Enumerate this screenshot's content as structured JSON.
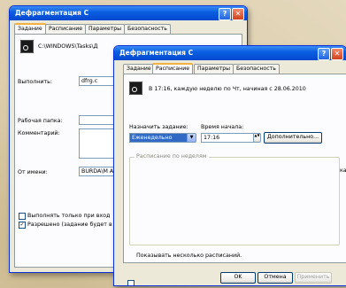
{
  "back_window": {
    "title": "Дефрагментация C",
    "tabs": [
      "Задание",
      "Расписание",
      "Параметры",
      "Безопасность"
    ],
    "task_path": "C:\\WINDOWS\\Tasks\\Д",
    "run_label": "Выполнить:",
    "run_value": "dfrg.c",
    "workdir_label": "Рабочая папка:",
    "comment_label": "Комментарий:",
    "runas_label": "От имени:",
    "runas_value": "BURDA\\M Ан",
    "only_if_logged_label": "Выполнять только при вход",
    "enabled_label": "Разрешено (задание будет в"
  },
  "front_window": {
    "title": "Дефрагментация C",
    "tabs": [
      "Задание",
      "Расписание",
      "Параметры",
      "Безопасность"
    ],
    "schedule_summary": "В 17:16, каждую неделю по Чт, начиная с 28.06.2010",
    "assign_label": "Назначить задание:",
    "assign_value": "Еженедельно",
    "start_time_label": "Время начала:",
    "start_time_value": "17:16",
    "advanced_button": "Дополнительно...",
    "weekly_group_label": "Расписание по неделям",
    "side_cut_text": "ка",
    "show_multiple_label": "Показывать несколько расписаний.",
    "ok_button": "OK",
    "cancel_button": "Отмена",
    "apply_button": "Применить"
  },
  "colors": {
    "titlebar": "#0548d0",
    "close_button": "#d2401b",
    "window_bg": "#ece9d8",
    "selected": "#316ac5"
  }
}
